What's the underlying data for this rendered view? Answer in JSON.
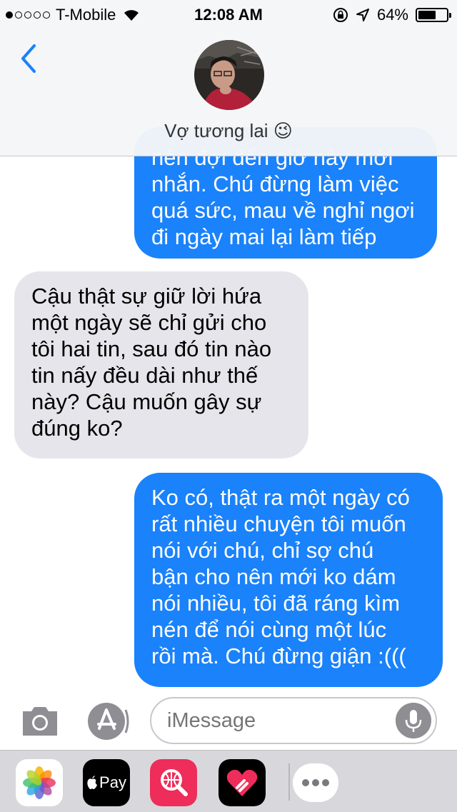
{
  "status_bar": {
    "carrier": "T-Mobile",
    "time": "12:08 AM",
    "battery": "64%",
    "battery_level": 0.64,
    "signal_bars": 1
  },
  "header": {
    "contact_name": "Vợ tương lai 😉"
  },
  "messages": [
    {
      "direction": "outgoing",
      "lines": [
        "nên đợi đến giờ này mới",
        "nhắn. Chú đừng làm việc",
        "quá sức, mau về nghỉ ngơi",
        "đi ngày mai lại làm tiếp"
      ]
    },
    {
      "direction": "incoming",
      "lines": [
        "Cậu thật sự giữ lời hứa",
        "một ngày sẽ chỉ gửi cho",
        "tôi hai tin, sau đó tin nào",
        "tin nấy đều dài như thế",
        "này? Cậu muốn gây sự",
        "đúng ko?"
      ]
    },
    {
      "direction": "outgoing",
      "lines": [
        "Ko có, thật ra một ngày có",
        "rất nhiều chuyện tôi muốn",
        "nói với chú, chỉ sợ chú",
        "bận cho nên mới ko dám",
        "nói nhiều, tôi đã ráng kìm",
        "nén để nói cùng một lúc",
        "rồi mà. Chú đừng giận :((("
      ]
    }
  ],
  "input": {
    "placeholder": "iMessage"
  },
  "app_drawer": {
    "apple_pay_label": "Pay"
  },
  "colors": {
    "outgoing_bubble": "#1a82fb",
    "incoming_bubble": "#e6e5eb",
    "accent": "#1a82fb"
  }
}
